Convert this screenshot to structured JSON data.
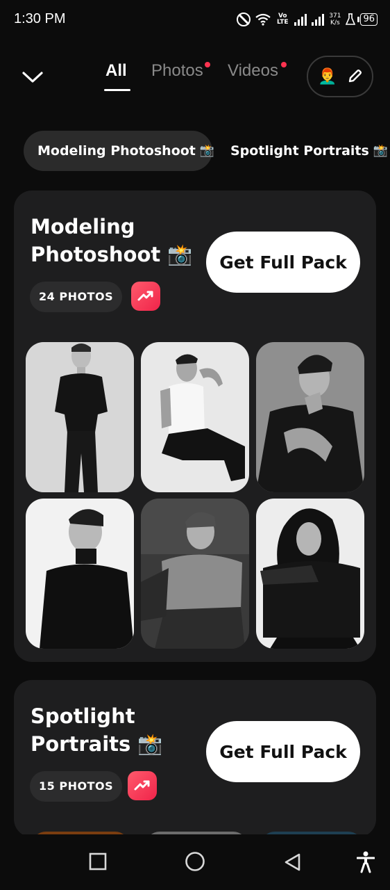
{
  "status_bar": {
    "time": "1:30 PM",
    "network": "Vo LTE",
    "net_speed_value": "371",
    "net_speed_unit": "K/s",
    "battery": "96"
  },
  "header": {
    "back_icon": "chevron-down-icon",
    "tabs": [
      {
        "label": "All",
        "active": true,
        "dot": false
      },
      {
        "label": "Photos",
        "active": false,
        "dot": true
      },
      {
        "label": "Videos",
        "active": false,
        "dot": true
      }
    ],
    "avatar_emoji": "👨‍🦰",
    "edit_icon": "pencil-icon"
  },
  "chips": [
    {
      "label": "Modeling Photoshoot",
      "emoji": "📸",
      "active": true
    },
    {
      "label": "Spotlight Portraits",
      "emoji": "📸",
      "active": false
    }
  ],
  "packs": [
    {
      "title_line1": "Modeling",
      "title_line2": "Photoshoot",
      "emoji": "📸",
      "count": "24 PHOTOS",
      "button": "Get Full Pack"
    },
    {
      "title_line1": "Spotlight",
      "title_line2": "Portraits",
      "emoji": "📸",
      "count": "15 PHOTOS",
      "button": "Get Full Pack"
    }
  ],
  "colors": {
    "background": "#0c0c0c",
    "card": "#1e1e1f",
    "accent_red": "#ff3350",
    "inactive_tab": "#8a8a8a"
  },
  "nav_bar": {
    "icons": [
      "recents-square-icon",
      "home-circle-icon",
      "back-triangle-icon",
      "accessibility-icon"
    ]
  }
}
